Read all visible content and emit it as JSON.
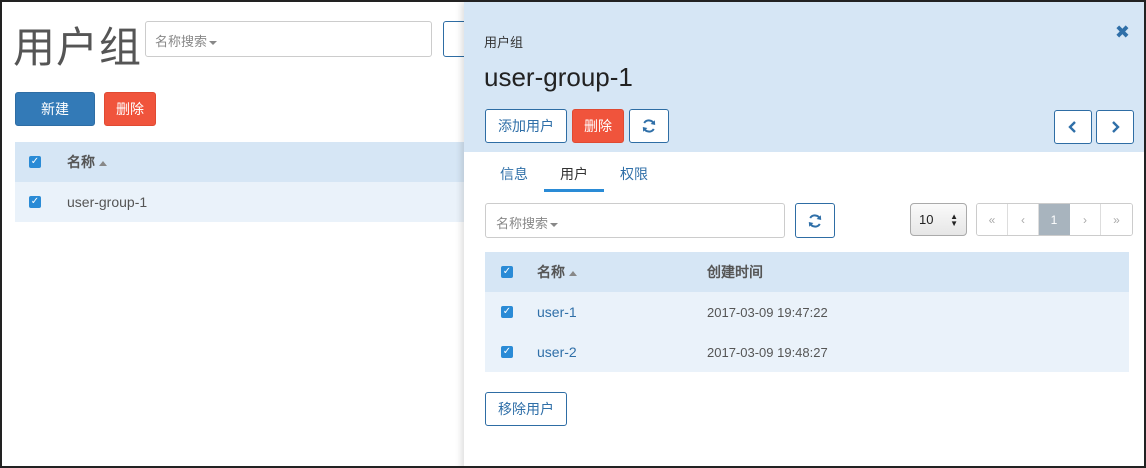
{
  "left": {
    "page_title": "用户组",
    "search_placeholder": "名称搜索",
    "new_label": "新建",
    "delete_label": "删除",
    "table": {
      "header_name": "名称",
      "rows": [
        {
          "name": "user-group-1"
        }
      ]
    }
  },
  "drawer": {
    "breadcrumb": "用户组",
    "title": "user-group-1",
    "add_user_label": "添加用户",
    "delete_label": "删除",
    "tabs": [
      {
        "label": "信息"
      },
      {
        "label": "用户"
      },
      {
        "label": "权限"
      }
    ],
    "active_tab": "用户",
    "search_placeholder": "名称搜索",
    "page_size": "10",
    "pagination": {
      "first": "«",
      "prev": "‹",
      "current": "1",
      "next": "›",
      "last": "»"
    },
    "table": {
      "header_name": "名称",
      "header_created": "创建时间",
      "rows": [
        {
          "name": "user-1",
          "created": "2017-03-09 19:47:22"
        },
        {
          "name": "user-2",
          "created": "2017-03-09 19:48:27"
        }
      ]
    },
    "remove_user_label": "移除用户"
  },
  "icons": {
    "close": "close-icon",
    "refresh": "refresh-icon",
    "prev": "chevron-left-icon",
    "next": "chevron-right-icon",
    "check": "checkbox-checked-icon",
    "sort": "sort-asc-icon"
  },
  "colors": {
    "primary": "#337ab7",
    "danger": "#f0543c",
    "header_bg": "#d6e6f5",
    "row_bg": "#eaf2fa",
    "link": "#2f6fa8"
  }
}
